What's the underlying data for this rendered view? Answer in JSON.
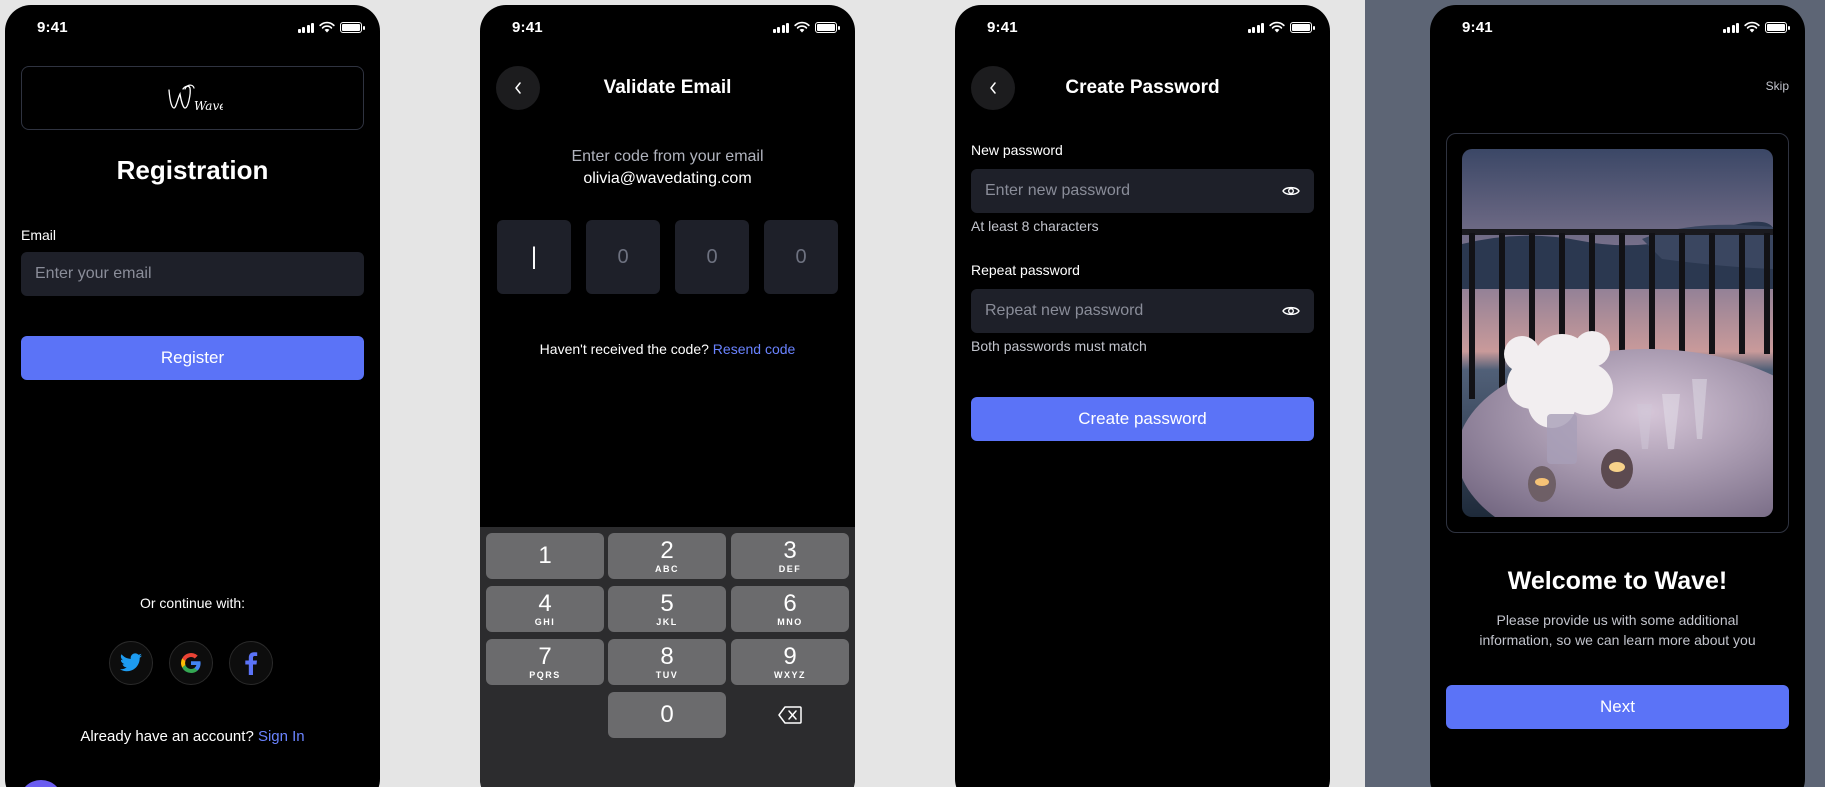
{
  "status_time": "9:41",
  "registration": {
    "logo_text": "Wave",
    "title": "Registration",
    "email_label": "Email",
    "email_placeholder": "Enter your email",
    "register_button": "Register",
    "continue_with": "Or continue with:",
    "social": [
      "twitter-icon",
      "google-icon",
      "facebook-icon"
    ],
    "have_account": "Already have an account?",
    "sign_in": "Sign In"
  },
  "validate": {
    "title": "Validate Email",
    "instruction": "Enter code from your email",
    "email": "olivia@wavedating.com",
    "otp_digits": [
      "|",
      "0",
      "0",
      "0"
    ],
    "not_received": "Haven't received the code?",
    "resend": "Resend code",
    "keys": [
      {
        "digit": "1",
        "letters": ""
      },
      {
        "digit": "2",
        "letters": "ABC"
      },
      {
        "digit": "3",
        "letters": "DEF"
      },
      {
        "digit": "4",
        "letters": "GHI"
      },
      {
        "digit": "5",
        "letters": "JKL"
      },
      {
        "digit": "6",
        "letters": "MNO"
      },
      {
        "digit": "7",
        "letters": "PQRS"
      },
      {
        "digit": "8",
        "letters": "TUV"
      },
      {
        "digit": "9",
        "letters": "WXYZ"
      },
      {
        "digit": "0",
        "letters": ""
      }
    ]
  },
  "create_password": {
    "title": "Create Password",
    "new_label": "New password",
    "new_placeholder": "Enter new password",
    "new_hint": "At least 8 characters",
    "repeat_label": "Repeat password",
    "repeat_placeholder": "Repeat new password",
    "repeat_hint": "Both passwords must match",
    "button": "Create password"
  },
  "welcome": {
    "skip": "Skip",
    "title": "Welcome to Wave!",
    "body": "Please provide us with some additional information, so we can learn more about you",
    "next": "Next"
  },
  "colors": {
    "accent": "#5b73f7",
    "link": "#6a83ff",
    "input_bg": "#1e2029",
    "background": "#000000"
  }
}
